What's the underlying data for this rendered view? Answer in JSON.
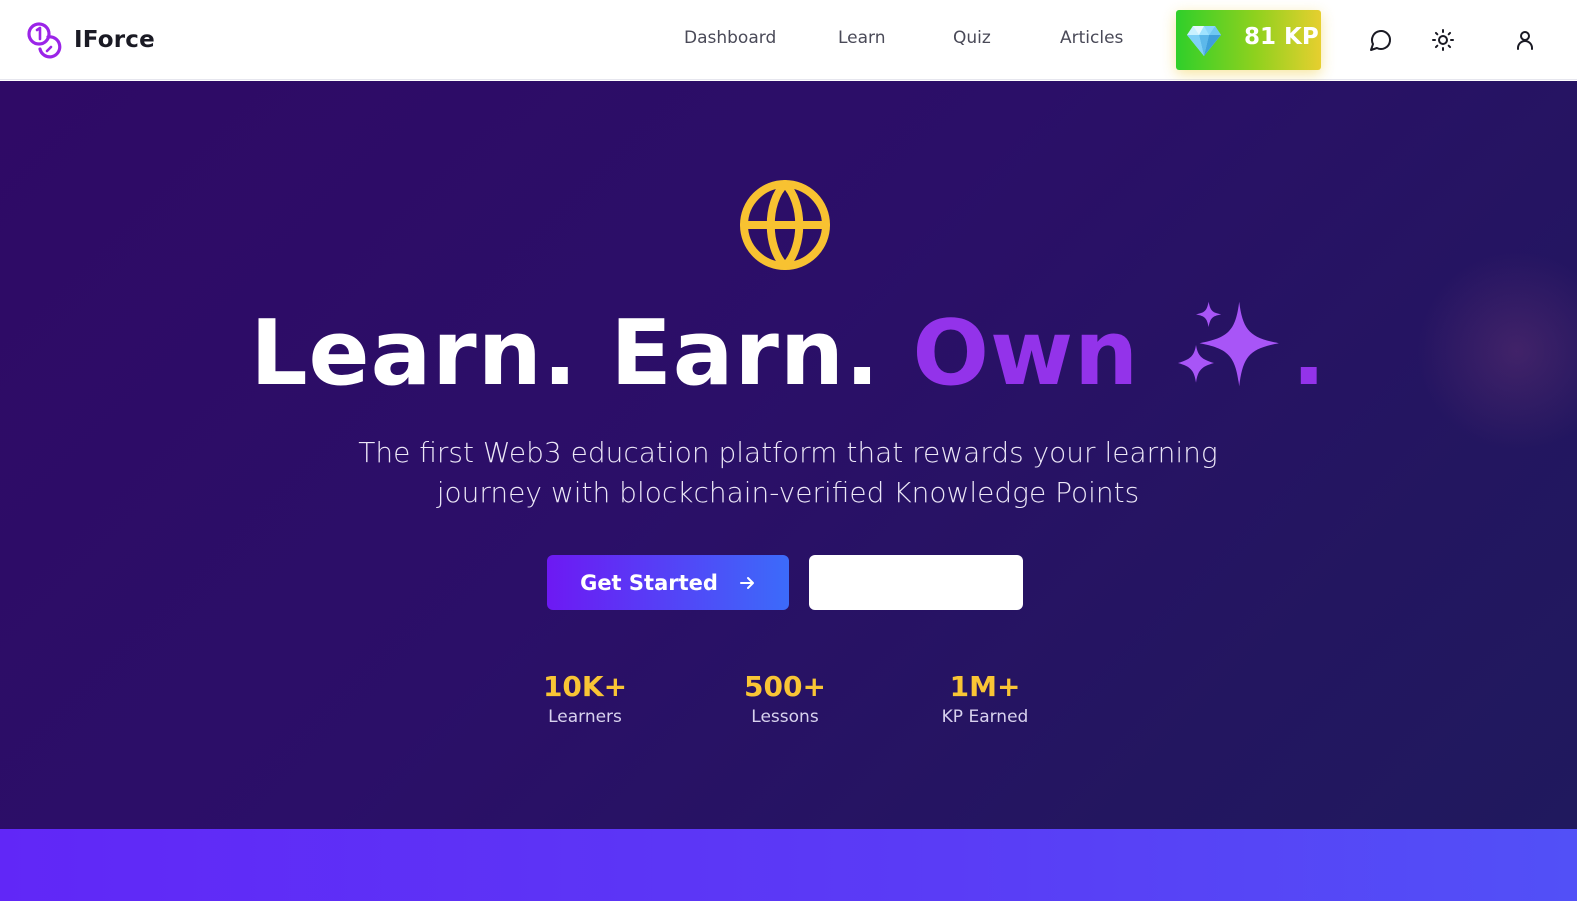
{
  "app": {
    "name": "IForce"
  },
  "nav": {
    "links": [
      {
        "label": "Dashboard"
      },
      {
        "label": "Learn"
      },
      {
        "label": "Quiz"
      },
      {
        "label": "Articles"
      }
    ],
    "kp_badge": {
      "label": "81 KP",
      "icon": "gem-icon"
    },
    "icons": [
      "chat-icon",
      "sun-icon",
      "user-icon"
    ]
  },
  "hero": {
    "icon": "globe-icon",
    "headline": {
      "part1": "Learn.",
      "part2": "Earn.",
      "part3": "Own",
      "part4": "."
    },
    "subtitle_line1": "The first Web3 education platform that rewards your learning",
    "subtitle_line2": "journey with blockchain-verified Knowledge Points",
    "primary_button": "Get Started",
    "secondary_button": "",
    "stats": [
      {
        "value": "10K+",
        "label": "Learners"
      },
      {
        "value": "500+",
        "label": "Lessons"
      },
      {
        "value": "1M+",
        "label": "KP Earned"
      }
    ]
  },
  "colors": {
    "accent_purple": "#9333ea",
    "stat_yellow": "#f9c535",
    "globe_yellow": "#f8c231",
    "kp_gradient": [
      "#2fcf2a",
      "#e6cf2f"
    ],
    "hero_bg": "#2b0f68"
  }
}
